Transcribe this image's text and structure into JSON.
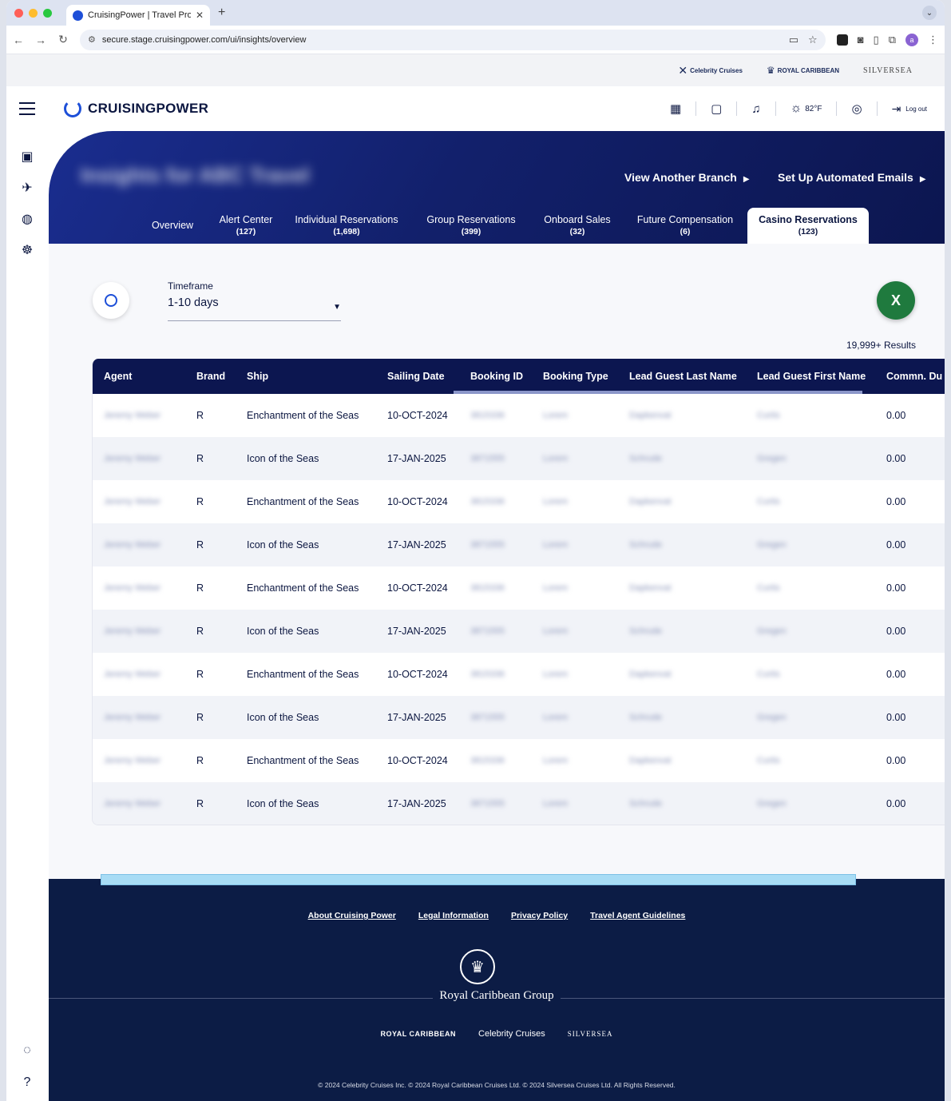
{
  "browser": {
    "tab_title": "CruisingPower | Travel Profes",
    "url": "secure.stage.cruisingpower.com/ui/insights/overview",
    "profile_initial": "a"
  },
  "brand_strip": {
    "celebrity": "Celebrity Cruises",
    "royal": "ROYAL CARIBBEAN",
    "silversea": "SILVERSEA"
  },
  "header": {
    "logo_text": "CRUISINGPOWER",
    "weather": "82°F",
    "logout": "Log out"
  },
  "hero": {
    "title": "Insights for ABC Travel",
    "view_branch": "View Another Branch",
    "automated_emails": "Set Up Automated Emails"
  },
  "tabs": [
    {
      "label": "Overview",
      "count": ""
    },
    {
      "label": "Alert Center",
      "count": "(127)"
    },
    {
      "label": "Individual Reservations",
      "count": "(1,698)"
    },
    {
      "label": "Group Reservations",
      "count": "(399)"
    },
    {
      "label": "Onboard Sales",
      "count": "(32)"
    },
    {
      "label": "Future Compensation",
      "count": "(6)"
    },
    {
      "label": "Casino Reservations",
      "count": "(123)"
    }
  ],
  "filters": {
    "timeframe_label": "Timeframe",
    "timeframe_value": "1-10 days",
    "excel_label": "X",
    "results": "19,999+  Results"
  },
  "table": {
    "headers": [
      "Agent",
      "Brand",
      "Ship",
      "Sailing Date",
      "Booking ID",
      "Booking Type",
      "Lead Guest Last Name",
      "Lead Guest First Name",
      "Commn. Du"
    ],
    "rows": [
      [
        "Jeremy Weber",
        "R",
        "Enchantment of the Seas",
        "10-OCT-2024",
        "3815336",
        "Lorem",
        "Dapkenvat",
        "Curtis",
        "0.00"
      ],
      [
        "Jeremy Weber",
        "R",
        "Icon of the Seas",
        "17-JAN-2025",
        "3871555",
        "Lorem",
        "Schrude",
        "Gregen",
        "0.00"
      ],
      [
        "Jeremy Weber",
        "R",
        "Enchantment of the Seas",
        "10-OCT-2024",
        "3815336",
        "Lorem",
        "Dapkenvat",
        "Curtis",
        "0.00"
      ],
      [
        "Jeremy Weber",
        "R",
        "Icon of the Seas",
        "17-JAN-2025",
        "3871555",
        "Lorem",
        "Schrude",
        "Gregen",
        "0.00"
      ],
      [
        "Jeremy Weber",
        "R",
        "Enchantment of the Seas",
        "10-OCT-2024",
        "3815336",
        "Lorem",
        "Dapkenvat",
        "Curtis",
        "0.00"
      ],
      [
        "Jeremy Weber",
        "R",
        "Icon of the Seas",
        "17-JAN-2025",
        "3871555",
        "Lorem",
        "Schrude",
        "Gregen",
        "0.00"
      ],
      [
        "Jeremy Weber",
        "R",
        "Enchantment of the Seas",
        "10-OCT-2024",
        "3815336",
        "Lorem",
        "Dapkenvat",
        "Curtis",
        "0.00"
      ],
      [
        "Jeremy Weber",
        "R",
        "Icon of the Seas",
        "17-JAN-2025",
        "3871555",
        "Lorem",
        "Schrude",
        "Gregen",
        "0.00"
      ],
      [
        "Jeremy Weber",
        "R",
        "Enchantment of the Seas",
        "10-OCT-2024",
        "3815336",
        "Lorem",
        "Dapkenvat",
        "Curtis",
        "0.00"
      ],
      [
        "Jeremy Weber",
        "R",
        "Icon of the Seas",
        "17-JAN-2025",
        "3871555",
        "Lorem",
        "Schrude",
        "Gregen",
        "0.00"
      ]
    ]
  },
  "footer": {
    "links": [
      "About Cruising Power",
      "Legal Information",
      "Privacy Policy",
      "Travel Agent Guidelines"
    ],
    "group_name": "Royal Caribbean Group",
    "brands": {
      "royal": "ROYAL CARIBBEAN",
      "celebrity": "Celebrity Cruises",
      "silversea": "SILVERSEA"
    },
    "copyright": "© 2024 Celebrity Cruises Inc. © 2024 Royal Caribbean Cruises Ltd. © 2024 Silversea Cruises Ltd. All Rights Reserved."
  },
  "colors": {
    "navy": "#0c1650",
    "accent": "#1d4fd8",
    "excel": "#1f7a3e",
    "footer": "#0c1c45"
  }
}
